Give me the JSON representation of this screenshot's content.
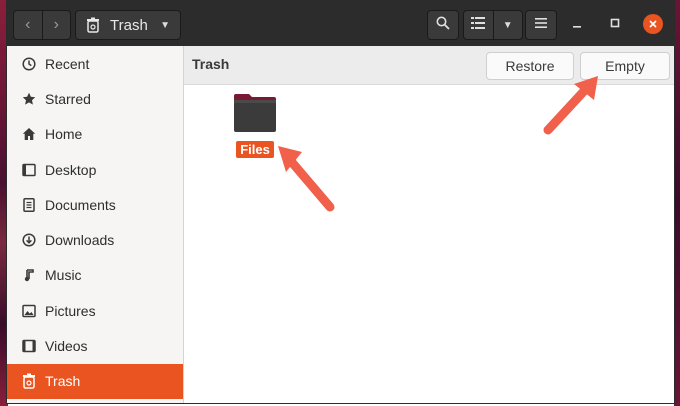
{
  "header": {
    "back_label": "‹",
    "forward_label": "›",
    "location": "Trash",
    "search_icon": "search-icon",
    "list_view_icon": "list-view-icon",
    "view_options_icon": "chevron-down-icon",
    "menu_icon": "hamburger-menu-icon",
    "minimize_icon": "minimize-icon",
    "maximize_icon": "maximize-icon",
    "close_icon": "close-icon"
  },
  "sidebar": {
    "items": [
      {
        "label": "Recent",
        "icon": "clock-icon"
      },
      {
        "label": "Starred",
        "icon": "star-icon"
      },
      {
        "label": "Home",
        "icon": "home-icon"
      },
      {
        "label": "Desktop",
        "icon": "desktop-icon"
      },
      {
        "label": "Documents",
        "icon": "document-icon"
      },
      {
        "label": "Downloads",
        "icon": "download-icon"
      },
      {
        "label": "Music",
        "icon": "music-icon"
      },
      {
        "label": "Pictures",
        "icon": "picture-icon"
      },
      {
        "label": "Videos",
        "icon": "video-icon"
      },
      {
        "label": "Trash",
        "icon": "trash-icon",
        "active": true
      }
    ]
  },
  "main": {
    "title": "Trash",
    "restore_label": "Restore",
    "empty_label": "Empty",
    "items": [
      {
        "label": "Files",
        "icon": "folder-icon",
        "selected": true
      }
    ]
  },
  "colors": {
    "accent": "#e95420",
    "headerbar": "#2c2c2c",
    "annotation_arrow": "#f0604a"
  }
}
